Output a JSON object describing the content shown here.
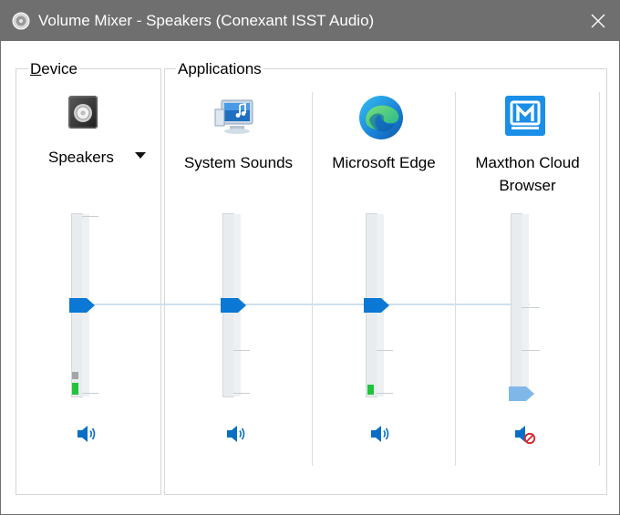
{
  "window": {
    "title": "Volume Mixer - Speakers (Conexant ISST Audio)"
  },
  "device_group": {
    "label_prefix": "D",
    "label_rest": "evice",
    "device_name": "Speakers",
    "icon": "speaker-device-icon",
    "volume_percent": 50,
    "peak_percent": 8,
    "muted": false
  },
  "applications_group": {
    "label": "Applications",
    "apps": [
      {
        "name": "System Sounds",
        "icon": "system-sounds-icon",
        "volume_percent": 50,
        "peak_percent": 0,
        "muted": false
      },
      {
        "name": "Microsoft Edge",
        "icon": "edge-icon",
        "volume_percent": 50,
        "peak_percent": 6,
        "muted": false
      },
      {
        "name": "Maxthon Cloud Browser",
        "name_line1": "Maxthon Cloud",
        "name_line2": "Browser",
        "icon": "maxthon-icon",
        "volume_percent": 0,
        "peak_percent": 0,
        "muted": true
      }
    ]
  },
  "colors": {
    "titlebar": "#6f6f6f",
    "accent": "#0a78d4",
    "meter_green": "#23c23c",
    "muted_thumb": "#7fb8e8",
    "mute_badge": "#d8232a"
  }
}
